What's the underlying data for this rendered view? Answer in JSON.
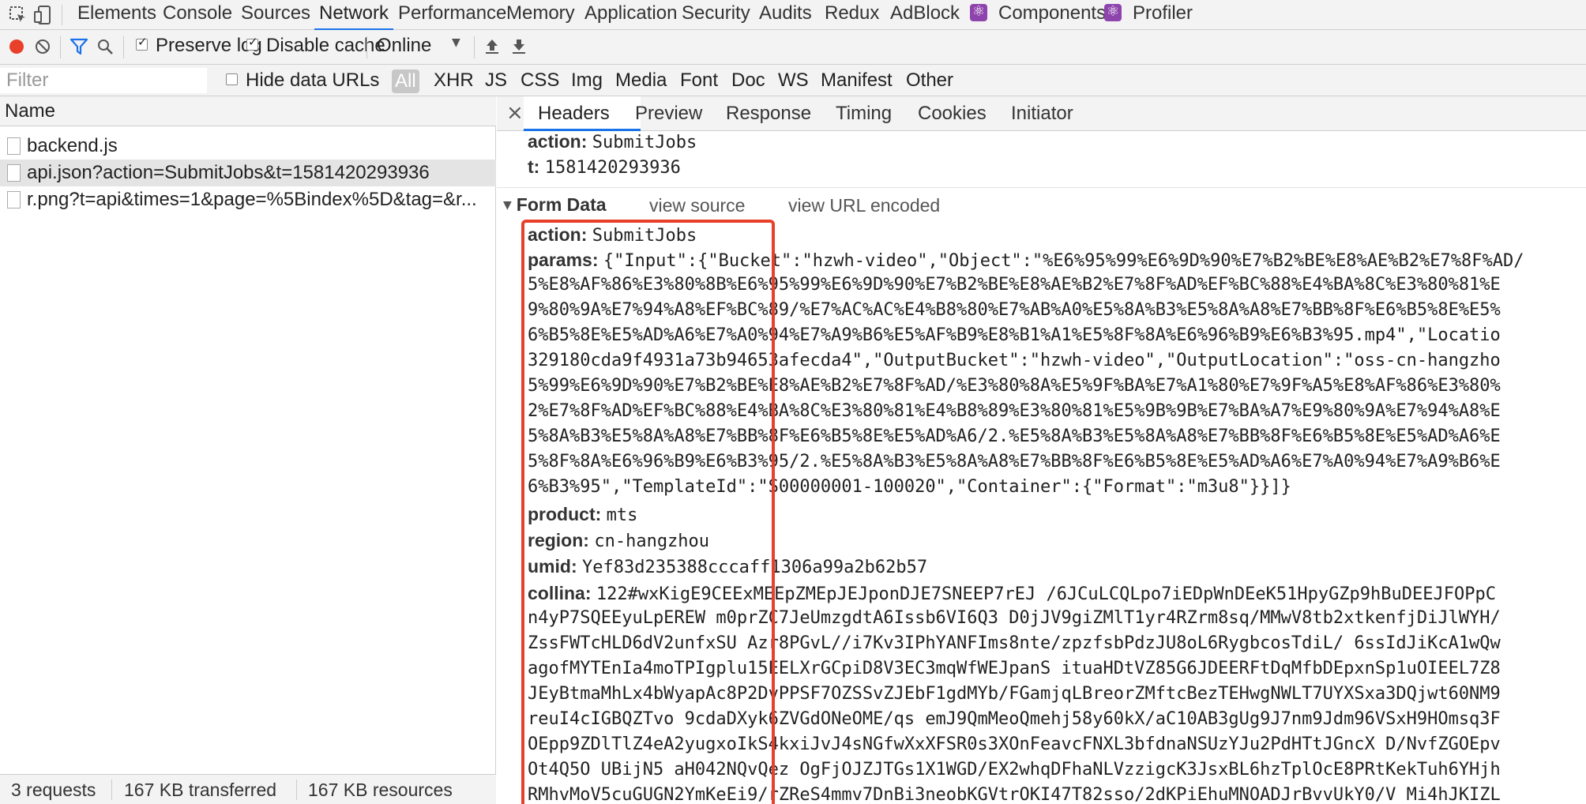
{
  "devtools": {
    "panel_tabs": [
      "Elements",
      "Console",
      "Sources",
      "Network",
      "Performance",
      "Memory",
      "Application",
      "Security",
      "Audits",
      "Redux",
      "AdBlock",
      "Components",
      "Profiler"
    ],
    "active_panel": "Network",
    "accent_color": "#1a73e8"
  },
  "toolbar": {
    "preserve_log_label": "Preserve log",
    "disable_cache_label": "Disable cache",
    "throttle_value": "Online",
    "record_color": "#e8402a"
  },
  "filter": {
    "placeholder": "Filter",
    "hide_data_urls_label": "Hide data URLs",
    "types": [
      "All",
      "XHR",
      "JS",
      "CSS",
      "Img",
      "Media",
      "Font",
      "Doc",
      "WS",
      "Manifest",
      "Other"
    ]
  },
  "requests": {
    "column_header": "Name",
    "items": [
      {
        "name": "backend.js"
      },
      {
        "name": "api.json?action=SubmitJobs&t=1581420293936"
      },
      {
        "name": "r.png?t=api&times=1&page=%5Bindex%5D&tag=&r..."
      }
    ],
    "status": {
      "requests": "3 requests",
      "transferred": "167 KB transferred",
      "resources": "167 KB resources"
    }
  },
  "detail": {
    "close": "×",
    "tabs": [
      "Headers",
      "Preview",
      "Response",
      "Timing",
      "Cookies",
      "Initiator"
    ],
    "query_params": [
      {
        "key": "action:",
        "value": "SubmitJobs"
      },
      {
        "key": "t:",
        "value": "1581420293936"
      }
    ],
    "form_data": {
      "title": "Form Data",
      "view_source": "view source",
      "view_url_encoded": "view URL encoded",
      "action_key": "action:",
      "action_value": "SubmitJobs",
      "params_key": "params:",
      "params_lines": [
        "{\"Input\":{\"Bucket\":\"hzwh-video\",\"Object\":\"%E6%95%99%E6%9D%90%E7%B2%BE%E8%AE%B2%E7%8F%AD/",
        "5%E8%AF%86%E3%80%8B%E6%95%99%E6%9D%90%E7%B2%BE%E8%AE%B2%E7%8F%AD%EF%BC%88%E4%BA%8C%E3%80%81%E",
        "9%80%9A%E7%94%A8%EF%BC%89/%E7%AC%AC%E4%B8%80%E7%AB%A0%E5%8A%B3%E5%8A%A8%E7%BB%8F%E6%B5%8E%E5%",
        "6%B5%8E%E5%AD%A6%E7%A0%94%E7%A9%B6%E5%AF%B9%E8%B1%A1%E5%8F%8A%E6%96%B9%E6%B3%95.mp4\",\"Locatio",
        "329180cda9f4931a73b94653afecda4\",\"OutputBucket\":\"hzwh-video\",\"OutputLocation\":\"oss-cn-hangzho",
        "5%99%E6%9D%90%E7%B2%BE%E8%AE%B2%E7%8F%AD/%E3%80%8A%E5%9F%BA%E7%A1%80%E7%9F%A5%E8%AF%86%E3%80%",
        "2%E7%8F%AD%EF%BC%88%E4%BA%8C%E3%80%81%E4%B8%89%E3%80%81%E5%9B%9B%E7%BA%A7%E9%80%9A%E7%94%A8%E",
        "5%8A%B3%E5%8A%A8%E7%BB%8F%E6%B5%8E%E5%AD%A6/2.%E5%8A%B3%E5%8A%A8%E7%BB%8F%E6%B5%8E%E5%AD%A6%E",
        "5%8F%8A%E6%96%B9%E6%B3%95/2.%E5%8A%B3%E5%8A%A8%E7%BB%8F%E6%B5%8E%E5%AD%A6%E7%A0%94%E7%A9%B6%E",
        "6%B3%95\",\"TemplateId\":\"S00000001-100020\",\"Container\":{\"Format\":\"m3u8\"}}]}"
      ],
      "product_key": "product:",
      "product_value": "mts",
      "region_key": "region:",
      "region_value": "cn-hangzhou",
      "umid_key": "umid:",
      "umid_value": "Yef83d235388cccaff1306a99a2b62b57",
      "collina_key": "collina:",
      "collina_lines": [
        "122#wxKigE9CEExMEEpZMEpJEJponDJE7SNEEP7rEJ /6JCuLCQLpo7iEDpWnDEeK51HpyGZp9hBuDEEJFOPpC",
        "n4yP7SQEEyuLpEREW m0prZC7JeUmzgdtA6Issb6VI6Q3 D0jJV9giZMlT1yr4RZrm8sq/MMwV8tb2xtkenfjDiJlWYH/",
        "ZssFWTcHLD6dV2unfxSU Azr8PGvL//i7Kv3IPhYANFIms8nte/zpzfsbPdzJU8oL6RygbcosTdiL/ 6ssIdJiKcA1wQw",
        "agofMYTEnIa4moTPIgplu15EELXrGCpiD8V3EC3mqWfWEJpanS ituaHDtVZ85G6JDEERFtDqMfbDEpxnSp1uOIEEL7Z8",
        "JEyBtmaMhLx4bWyapAc8P2DvPPSF7OZSSvZJEbF1gdMYb/FGamjqLBreorZMftcBezTEHwgNWLT7UYXSxa3DQjwt60NM9",
        "reuI4cIGBQZTvo 9cdaDXyk6ZVGdONeOME/qs emJ9QmMeoQmehj58y60kX/aC10AB3gUg9J7nm9Jdm96VSxH9HOmsq3F",
        "OEpp9ZDlTlZ4eA2yugxoIkS4kxiJvJ4sNGfwXxXFSR0s3XOnFeavcFNXL3bfdnaNSUzYJu2PdHTtJGncX D/NvfZGOEpv",
        "Ot4Q5O UBijN5 aH042NQvQez OgFjOJZJTGs1X1WGD/EX2whqDFhaNLVzzigcK3JsxBL6hzTplOcE8PRtKekTuh6YHjh",
        "RMhvMoV5cuGUGN2YmKeEi9/rZReS4mmv7DnBi3neobKGVtrOKI47T82sso/2dKPiEhuMNOADJrBvvUkY0/V Mi4hJKIZL"
      ]
    }
  }
}
